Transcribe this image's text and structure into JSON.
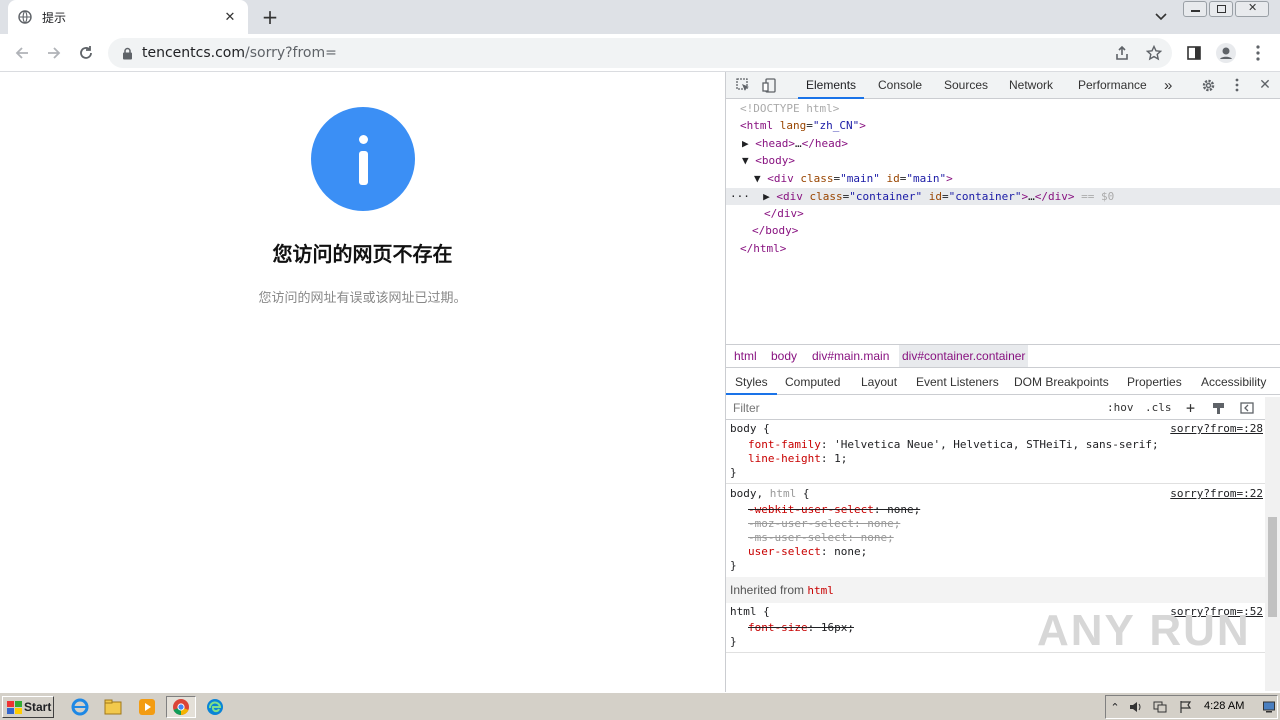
{
  "browser": {
    "tab_title": "提示",
    "url_host": "tencentcs.com",
    "url_path": "/sorry?from="
  },
  "page": {
    "heading": "您访问的网页不存在",
    "subtext": "您访问的网址有误或该网址已过期。",
    "info_icon_color": "#3b8ff5"
  },
  "devtools": {
    "tabs": [
      "Elements",
      "Console",
      "Sources",
      "Network",
      "Performance"
    ],
    "active_tab": "Elements",
    "breadcrumbs": [
      "html",
      "body",
      "div#main.main",
      "div#container.container"
    ],
    "styles_tabs": [
      "Styles",
      "Computed",
      "Layout",
      "Event Listeners",
      "DOM Breakpoints",
      "Properties",
      "Accessibility"
    ],
    "filter_placeholder": "Filter",
    "hov": ":hov",
    "cls": ".cls",
    "inherited_label": "Inherited from",
    "inherited_tag": "html",
    "sources": [
      "sorry?from=:28",
      "sorry?from=:22",
      "sorry?from=:52"
    ]
  },
  "taskbar": {
    "start_label": "Start",
    "clock": "4:28 AM"
  },
  "watermark": "ANY RUN"
}
